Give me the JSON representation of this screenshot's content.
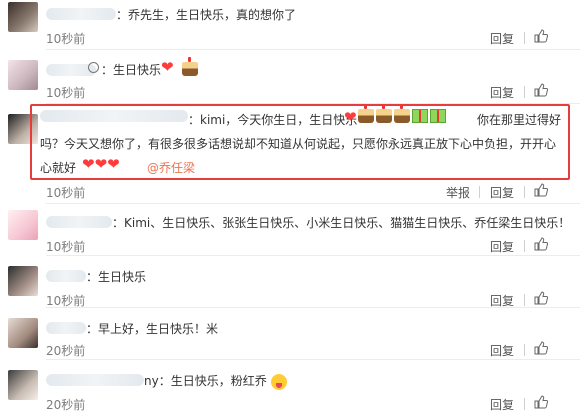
{
  "actions": {
    "reply": "回复",
    "report": "举报"
  },
  "comments": [
    {
      "text": "：乔先生，生日快乐，真的想你了",
      "time": "10秒前",
      "likes": ""
    },
    {
      "text": "：生日快乐",
      "time": "10秒前",
      "likes": ""
    },
    {
      "line1": "：kimi，今天你生日，生日快乐",
      "line1_tail": "你在那里过得好",
      "line2": "吗？今天又想你了，有很多很多话想说却不知道从何说起，只愿你永远真正放下心中负担，开开心",
      "line3": "心就好",
      "mention": "@乔任梁",
      "time": "10秒前",
      "likes": ""
    },
    {
      "text": "：Kimi、生日快乐、张张生日快乐、小米生日快乐、猫猫生日快乐、乔任梁生日快乐！",
      "time": "10秒前",
      "likes": ""
    },
    {
      "text": "：生日快乐",
      "time": "10秒前",
      "likes": ""
    },
    {
      "text": "：早上好，生日快乐！米",
      "time": "20秒前",
      "likes": ""
    },
    {
      "text": "ny：生日快乐，粉红乔",
      "time": "20秒前",
      "likes": ""
    }
  ],
  "icons": {
    "like": "thumbs-up-icon",
    "heart": "heart-emoji-icon"
  },
  "colors": {
    "highlight": "#e63c3c",
    "mention": "#eb7350"
  }
}
